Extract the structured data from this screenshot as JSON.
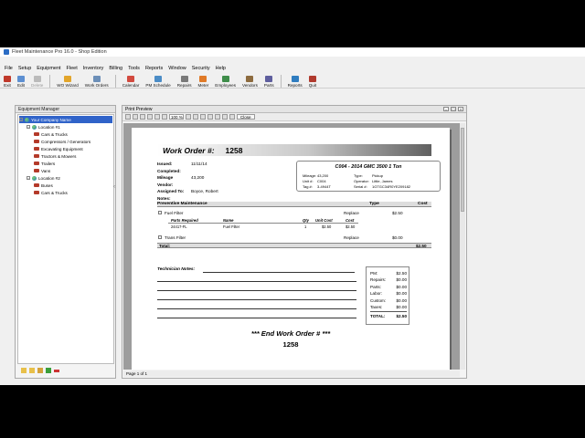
{
  "app": {
    "title": "Fleet Maintenance Pro 16.0 - Shop Edition"
  },
  "menu": [
    "File",
    "Setup",
    "Equipment",
    "Fleet",
    "Inventory",
    "Billing",
    "Tools",
    "Reports",
    "Window",
    "Security",
    "Help"
  ],
  "toolbar": [
    {
      "label": "Exit",
      "color": "#c0392b",
      "enabled": true
    },
    {
      "label": "Edit",
      "color": "#5d8fd1",
      "enabled": true
    },
    {
      "label": "Delete",
      "color": "#bbbbbb",
      "enabled": false
    },
    {
      "label": "WO Wizard",
      "color": "#e2a52b",
      "enabled": true
    },
    {
      "label": "Work Orders",
      "color": "#6c8fb8",
      "enabled": true
    },
    {
      "label": "Calendar",
      "color": "#d24a3f",
      "enabled": true
    },
    {
      "label": "PM Schedule",
      "color": "#4b8cc6",
      "enabled": true
    },
    {
      "label": "Repairs",
      "color": "#7a7a7a",
      "enabled": true
    },
    {
      "label": "Meter",
      "color": "#e07a27",
      "enabled": true
    },
    {
      "label": "Employees",
      "color": "#3f8d4a",
      "enabled": true
    },
    {
      "label": "Vendors",
      "color": "#8d6b3f",
      "enabled": true
    },
    {
      "label": "Parts",
      "color": "#5e5e9e",
      "enabled": true
    },
    {
      "label": "Reports",
      "color": "#2f7dc0",
      "enabled": true
    },
    {
      "label": "Quit",
      "color": "#b03a2e",
      "enabled": true
    }
  ],
  "equipment_manager": {
    "title": "Equipment Manager",
    "tree": [
      {
        "label": "Your Company Name",
        "level": 0,
        "kind": "globe",
        "selected": true
      },
      {
        "label": "Location #1",
        "level": 1,
        "kind": "globe",
        "selected": false
      },
      {
        "label": "Cars & Trucks",
        "level": 2,
        "kind": "truck",
        "selected": false
      },
      {
        "label": "Compressors / Generators",
        "level": 2,
        "kind": "truck",
        "selected": false
      },
      {
        "label": "Excavating Equipment",
        "level": 2,
        "kind": "truck",
        "selected": false
      },
      {
        "label": "Tractors & Mowers",
        "level": 2,
        "kind": "truck",
        "selected": false
      },
      {
        "label": "Trailers",
        "level": 2,
        "kind": "truck",
        "selected": false
      },
      {
        "label": "Vans",
        "level": 2,
        "kind": "truck",
        "selected": false
      },
      {
        "label": "Location #2",
        "level": 1,
        "kind": "globe",
        "selected": false
      },
      {
        "label": "Buses",
        "level": 2,
        "kind": "truck",
        "selected": false
      },
      {
        "label": "Cars & Trucks",
        "level": 2,
        "kind": "truck",
        "selected": false
      }
    ]
  },
  "print_preview": {
    "title": "Print Preview",
    "zoom": "100 %",
    "close_label": "Close",
    "status": "Page 1 of 1"
  },
  "work_order": {
    "label": "Work Order #:",
    "number": "1258",
    "fields": [
      {
        "k": "Issued:",
        "v": "11/11/14"
      },
      {
        "k": "Completed:",
        "v": ""
      },
      {
        "k": "Mileage",
        "v": "43,200"
      },
      {
        "k": "Vendor:",
        "v": ""
      },
      {
        "k": "Assigned To:",
        "v": "Boyce, Robert"
      },
      {
        "k": "Notes:",
        "v": ""
      }
    ],
    "unit": {
      "title": "C004 - 2014 GMC 3500 1 Ton",
      "rows": [
        [
          "Mileage:",
          "43,200",
          "Type:",
          "Pickup"
        ],
        [
          "Unit #:",
          "C004",
          "Operator:",
          "Little, James"
        ],
        [
          "Tag #:",
          "3-4944T",
          "Serial #:",
          "1GTGC34R0YE209182"
        ]
      ]
    },
    "pm_header": {
      "title": "Preventive Maintenance",
      "type": "Type",
      "cost": "Cost"
    },
    "fuel_filter": {
      "name": "Fuel Filter",
      "type": "Replace",
      "cost": "$2.50"
    },
    "parts_header": {
      "parts": "Parts Required",
      "name": "Name",
      "qty": "Qty",
      "unit_cost": "Unit Cost",
      "cost": "Cost"
    },
    "parts_row": {
      "part": "24417-FL",
      "name": "Fuel Filter",
      "qty": "1",
      "unit_cost": "$2.50",
      "cost": "$2.50"
    },
    "trans_filter": {
      "name": "Trans Filter",
      "type": "Replace",
      "cost": "$0.00"
    },
    "total": {
      "label": "Total:",
      "value": "$2.50"
    },
    "tech_notes_label": "Technician Notes:",
    "summary": [
      {
        "k": "PM:",
        "v": "$2.50"
      },
      {
        "k": "Repairs:",
        "v": "$0.00"
      },
      {
        "k": "Parts:",
        "v": "$0.00"
      },
      {
        "k": "Labor:",
        "v": "$0.00"
      },
      {
        "k": "Custom:",
        "v": "$0.00"
      },
      {
        "k": "Taxes:",
        "v": "$0.00"
      },
      {
        "k": "TOTAL:",
        "v": "$2.50"
      }
    ],
    "end_label": "*** End Work Order # ***",
    "end_number": "1258"
  }
}
